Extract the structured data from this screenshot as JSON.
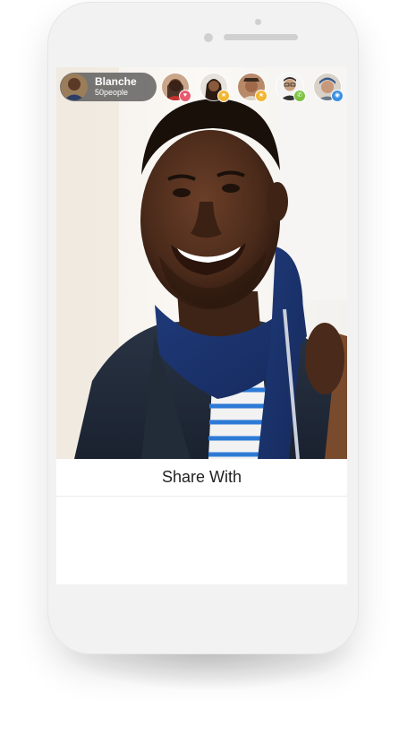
{
  "header": {
    "user": {
      "name": "Blanche",
      "count": "50people"
    },
    "friends": [
      {
        "avatar": "friend-avatar-1",
        "badge": "heart-icon",
        "color": "#e85a6e"
      },
      {
        "avatar": "friend-avatar-2",
        "badge": "star-icon",
        "color": "#f2b632"
      },
      {
        "avatar": "friend-avatar-3",
        "badge": "star-icon",
        "color": "#f2b632"
      },
      {
        "avatar": "friend-avatar-4",
        "badge": "phone-icon",
        "color": "#7dc242"
      },
      {
        "avatar": "friend-avatar-5",
        "badge": "camera-icon",
        "color": "#3a8fe0"
      }
    ]
  },
  "share": {
    "title": "Share With"
  },
  "colors": {
    "pill": "#464646",
    "screen": "#ffffff",
    "phone": "#f2f2f2"
  }
}
